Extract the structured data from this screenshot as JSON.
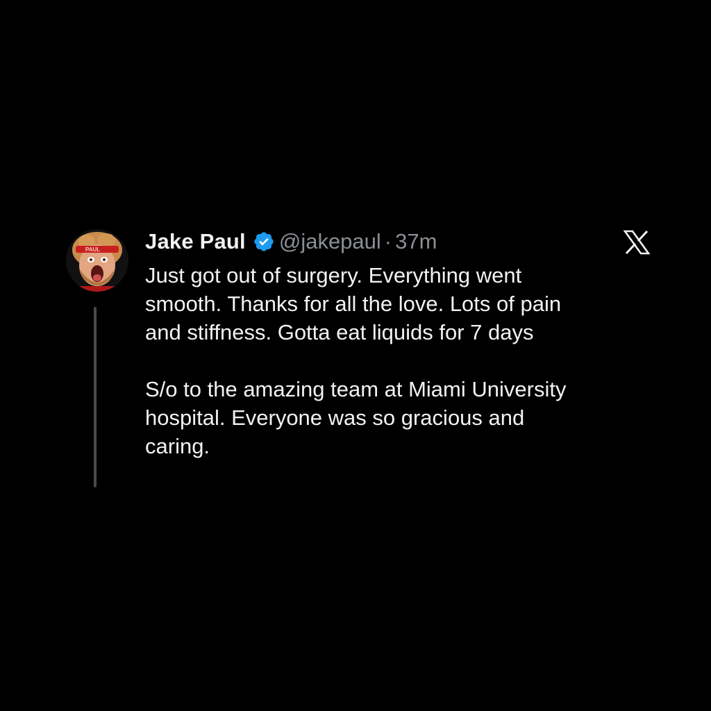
{
  "tweet": {
    "display_name": "Jake Paul",
    "handle": "@jakepaul",
    "separator": "·",
    "time": "37m",
    "avatar_icon": "profile-photo",
    "verified_icon": "verified-badge-icon",
    "brand_icon": "x-logo-icon",
    "paragraphs": [
      [
        "Just got out of surgery. Everything went",
        "smooth. Thanks for all the love. Lots of pain",
        "and stiffness. Gotta eat liquids for 7 days"
      ],
      [
        "S/o to the amazing team at Miami University",
        "hospital. Everyone was so gracious and",
        "caring."
      ]
    ]
  },
  "colors": {
    "background": "#000000",
    "text": "#f2f2f2",
    "muted": "#8b8f94",
    "verified": "#1d9bf0",
    "thread_line": "#4a4a4a"
  }
}
